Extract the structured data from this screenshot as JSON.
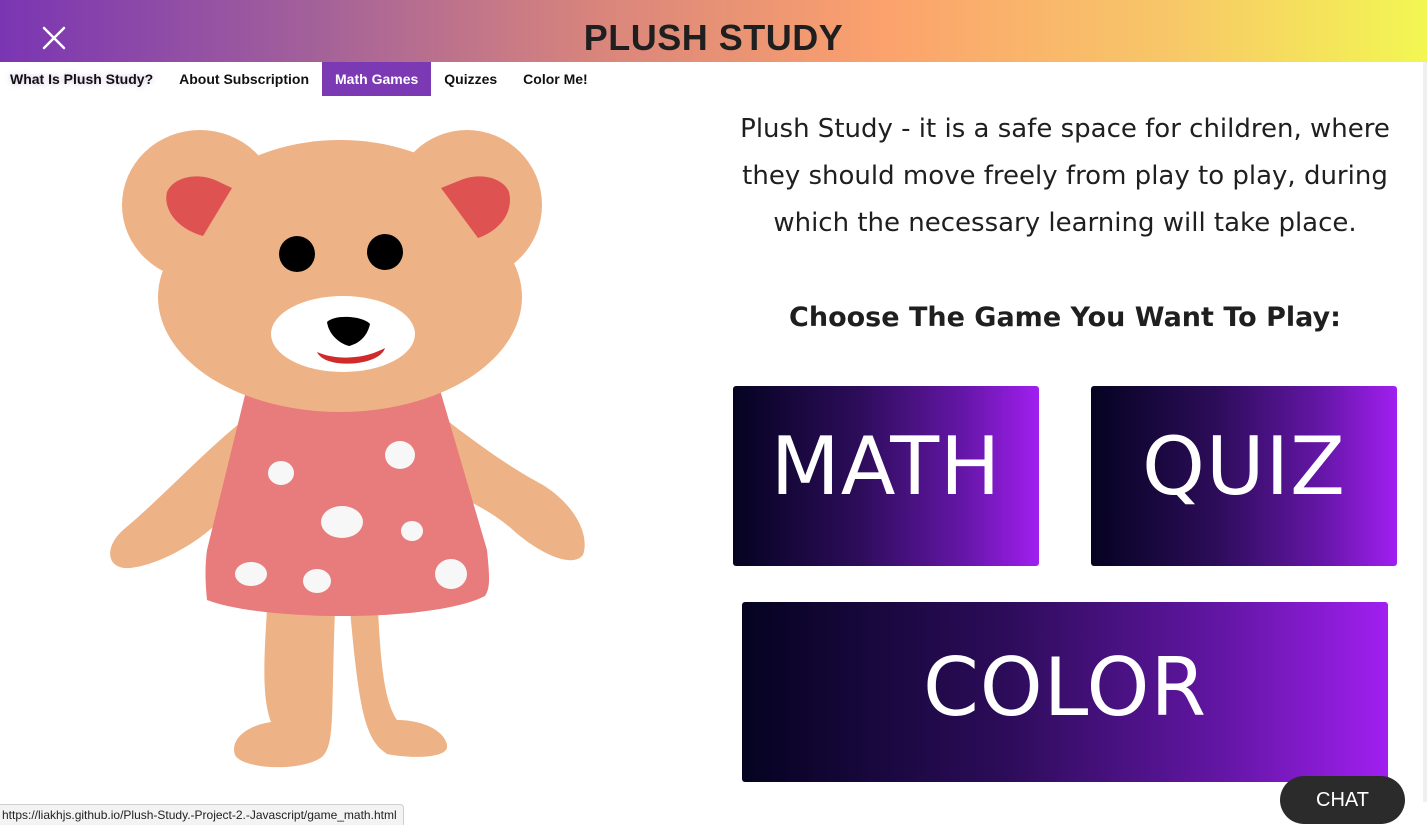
{
  "header": {
    "title": "PLUSH STUDY",
    "close_icon": "close-x-icon",
    "gradient_colors": [
      "#7a35b3",
      "#fba26d",
      "#f2f752"
    ]
  },
  "nav": {
    "items": [
      {
        "label": "What Is Plush Study?",
        "active": false
      },
      {
        "label": "About Subscription",
        "active": false
      },
      {
        "label": "Math Games",
        "active": true
      },
      {
        "label": "Quizzes",
        "active": false
      },
      {
        "label": "Color Me!",
        "active": false
      }
    ],
    "active_color": "#7b3ab4"
  },
  "main": {
    "intro": "Plush Study - it is a safe space for children, where they should move freely from play to play, during which the necessary learning will take place.",
    "choose_heading": "Choose The Game You Want To Play:",
    "buttons": {
      "math": "MATH",
      "quiz": "QUIZ",
      "color": "COLOR"
    },
    "button_gradient": [
      "#050321",
      "#a11ff0"
    ]
  },
  "status_bar": {
    "url": "https://liakhjs.github.io/Plush-Study.-Project-2.-Javascript/game_math.html"
  },
  "chat": {
    "label": "CHAT"
  }
}
